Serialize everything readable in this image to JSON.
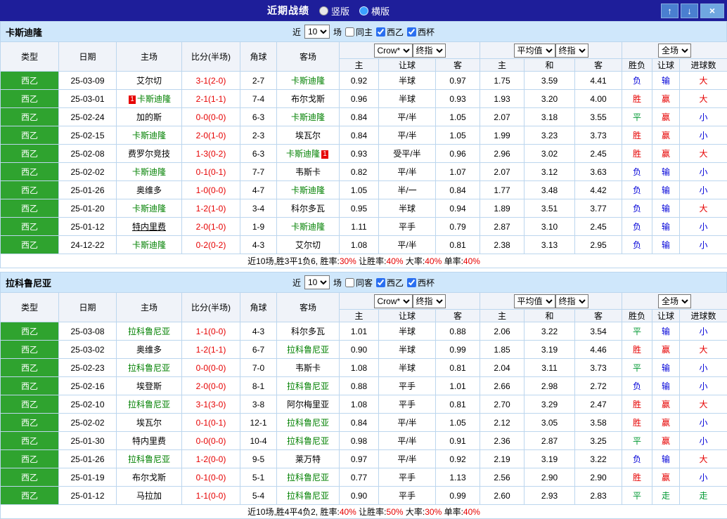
{
  "titlebar": {
    "title": "近期战绩",
    "layout_options": [
      {
        "label": "竖版",
        "selected": false
      },
      {
        "label": "横版",
        "selected": true
      }
    ],
    "buttons": {
      "up": "↑",
      "down": "↓",
      "close": "×"
    }
  },
  "colors": {
    "titlebar_bg": "#1e1e9a",
    "section_bg": "#cfe7fb",
    "header_bg": "#f0f3f9",
    "grid_border": "#bcd6ee",
    "league_badge_bg": "#2fa32f",
    "focus_team_green": "#008000",
    "result_red": "#e60000",
    "result_blue": "#0000d8",
    "result_green": "#009933"
  },
  "sections": [
    {
      "team": "卡斯迪隆",
      "filters": {
        "near_label": "近",
        "count": "10",
        "unit_label": "场",
        "checkboxes": [
          {
            "label": "同主",
            "checked": false
          },
          {
            "label": "西乙",
            "checked": true
          },
          {
            "label": "西杯",
            "checked": true
          }
        ]
      },
      "table": {
        "static_headers": [
          "类型",
          "日期",
          "主场",
          "比分(半场)",
          "角球",
          "客场"
        ],
        "odds_selects": [
          "Crow*",
          "终指"
        ],
        "odds_subheaders": [
          "主",
          "让球",
          "客"
        ],
        "avg_selects": [
          "平均值",
          "终指"
        ],
        "avg_subheaders": [
          "主",
          "和",
          "客"
        ],
        "result_select": "全场",
        "result_subheaders": [
          "胜负",
          "让球",
          "进球数"
        ]
      },
      "rows": [
        {
          "league": "西乙",
          "date": "25-03-09",
          "home": {
            "name": "艾尔切"
          },
          "score": "3-1(2-0)",
          "corners": "2-7",
          "away": {
            "name": "卡斯迪隆",
            "focus": true
          },
          "odds": [
            "0.92",
            "半球",
            "0.97"
          ],
          "averages": [
            "1.75",
            "3.59",
            "4.41"
          ],
          "results": [
            [
              "负",
              "blue"
            ],
            [
              "输",
              "blue"
            ],
            [
              "大",
              "red"
            ]
          ]
        },
        {
          "league": "西乙",
          "date": "25-03-01",
          "home": {
            "name": "卡斯迪隆",
            "focus": true,
            "badge_before": "1"
          },
          "score": "2-1(1-1)",
          "corners": "7-4",
          "away": {
            "name": "布尔戈斯"
          },
          "odds": [
            "0.96",
            "半球",
            "0.93"
          ],
          "averages": [
            "1.93",
            "3.20",
            "4.00"
          ],
          "results": [
            [
              "胜",
              "red"
            ],
            [
              "赢",
              "red"
            ],
            [
              "大",
              "red"
            ]
          ]
        },
        {
          "league": "西乙",
          "date": "25-02-24",
          "home": {
            "name": "加的斯"
          },
          "score": "0-0(0-0)",
          "corners": "6-3",
          "away": {
            "name": "卡斯迪隆",
            "focus": true
          },
          "odds": [
            "0.84",
            "平/半",
            "1.05"
          ],
          "averages": [
            "2.07",
            "3.18",
            "3.55"
          ],
          "results": [
            [
              "平",
              "green"
            ],
            [
              "赢",
              "red"
            ],
            [
              "小",
              "blue"
            ]
          ]
        },
        {
          "league": "西乙",
          "date": "25-02-15",
          "home": {
            "name": "卡斯迪隆",
            "focus": true
          },
          "score": "2-0(1-0)",
          "corners": "2-3",
          "away": {
            "name": "埃瓦尔"
          },
          "odds": [
            "0.84",
            "平/半",
            "1.05"
          ],
          "averages": [
            "1.99",
            "3.23",
            "3.73"
          ],
          "results": [
            [
              "胜",
              "red"
            ],
            [
              "赢",
              "red"
            ],
            [
              "小",
              "blue"
            ]
          ]
        },
        {
          "league": "西乙",
          "date": "25-02-08",
          "home": {
            "name": "费罗尔竞技"
          },
          "score": "1-3(0-2)",
          "corners": "6-3",
          "away": {
            "name": "卡斯迪隆",
            "focus": true,
            "badge_after": "1"
          },
          "odds": [
            "0.93",
            "受平/半",
            "0.96"
          ],
          "averages": [
            "2.96",
            "3.02",
            "2.45"
          ],
          "results": [
            [
              "胜",
              "red"
            ],
            [
              "赢",
              "red"
            ],
            [
              "大",
              "red"
            ]
          ]
        },
        {
          "league": "西乙",
          "date": "25-02-02",
          "home": {
            "name": "卡斯迪隆",
            "focus": true
          },
          "score": "0-1(0-1)",
          "corners": "7-7",
          "away": {
            "name": "韦斯卡"
          },
          "odds": [
            "0.82",
            "平/半",
            "1.07"
          ],
          "averages": [
            "2.07",
            "3.12",
            "3.63"
          ],
          "results": [
            [
              "负",
              "blue"
            ],
            [
              "输",
              "blue"
            ],
            [
              "小",
              "blue"
            ]
          ]
        },
        {
          "league": "西乙",
          "date": "25-01-26",
          "home": {
            "name": "奥维多"
          },
          "score": "1-0(0-0)",
          "corners": "4-7",
          "away": {
            "name": "卡斯迪隆",
            "focus": true
          },
          "odds": [
            "1.05",
            "半/一",
            "0.84"
          ],
          "averages": [
            "1.77",
            "3.48",
            "4.42"
          ],
          "results": [
            [
              "负",
              "blue"
            ],
            [
              "输",
              "blue"
            ],
            [
              "小",
              "blue"
            ]
          ]
        },
        {
          "league": "西乙",
          "date": "25-01-20",
          "home": {
            "name": "卡斯迪隆",
            "focus": true
          },
          "score": "1-2(1-0)",
          "corners": "3-4",
          "away": {
            "name": "科尔多瓦"
          },
          "odds": [
            "0.95",
            "半球",
            "0.94"
          ],
          "averages": [
            "1.89",
            "3.51",
            "3.77"
          ],
          "results": [
            [
              "负",
              "blue"
            ],
            [
              "输",
              "blue"
            ],
            [
              "大",
              "red"
            ]
          ]
        },
        {
          "league": "西乙",
          "date": "25-01-12",
          "home": {
            "name": "特内里费",
            "underline": true
          },
          "score": "2-0(1-0)",
          "corners": "1-9",
          "away": {
            "name": "卡斯迪隆",
            "focus": true
          },
          "odds": [
            "1.11",
            "平手",
            "0.79"
          ],
          "averages": [
            "2.87",
            "3.10",
            "2.45"
          ],
          "results": [
            [
              "负",
              "blue"
            ],
            [
              "输",
              "blue"
            ],
            [
              "小",
              "blue"
            ]
          ]
        },
        {
          "league": "西乙",
          "date": "24-12-22",
          "home": {
            "name": "卡斯迪隆",
            "focus": true
          },
          "score": "0-2(0-2)",
          "corners": "4-3",
          "away": {
            "name": "艾尔切"
          },
          "odds": [
            "1.08",
            "平/半",
            "0.81"
          ],
          "averages": [
            "2.38",
            "3.13",
            "2.95"
          ],
          "results": [
            [
              "负",
              "blue"
            ],
            [
              "输",
              "blue"
            ],
            [
              "小",
              "blue"
            ]
          ]
        }
      ],
      "summary": {
        "record": "近10场,胜3平1负6,",
        "stats": [
          {
            "label": "胜率:",
            "value": "30%"
          },
          {
            "label": "让胜率:",
            "value": "40%"
          },
          {
            "label": "大率:",
            "value": "40%"
          },
          {
            "label": "单率:",
            "value": "40%"
          }
        ]
      }
    },
    {
      "team": "拉科鲁尼亚",
      "filters": {
        "near_label": "近",
        "count": "10",
        "unit_label": "场",
        "checkboxes": [
          {
            "label": "同客",
            "checked": false
          },
          {
            "label": "西乙",
            "checked": true
          },
          {
            "label": "西杯",
            "checked": true
          }
        ]
      },
      "table": {
        "static_headers": [
          "类型",
          "日期",
          "主场",
          "比分(半场)",
          "角球",
          "客场"
        ],
        "odds_selects": [
          "Crow*",
          "终指"
        ],
        "odds_subheaders": [
          "主",
          "让球",
          "客"
        ],
        "avg_selects": [
          "平均值",
          "终指"
        ],
        "avg_subheaders": [
          "主",
          "和",
          "客"
        ],
        "result_select": "全场",
        "result_subheaders": [
          "胜负",
          "让球",
          "进球数"
        ]
      },
      "rows": [
        {
          "league": "西乙",
          "date": "25-03-08",
          "home": {
            "name": "拉科鲁尼亚",
            "focus": true
          },
          "score": "1-1(0-0)",
          "corners": "4-3",
          "away": {
            "name": "科尔多瓦"
          },
          "odds": [
            "1.01",
            "半球",
            "0.88"
          ],
          "averages": [
            "2.06",
            "3.22",
            "3.54"
          ],
          "results": [
            [
              "平",
              "green"
            ],
            [
              "输",
              "blue"
            ],
            [
              "小",
              "blue"
            ]
          ]
        },
        {
          "league": "西乙",
          "date": "25-03-02",
          "home": {
            "name": "奥维多"
          },
          "score": "1-2(1-1)",
          "corners": "6-7",
          "away": {
            "name": "拉科鲁尼亚",
            "focus": true
          },
          "odds": [
            "0.90",
            "半球",
            "0.99"
          ],
          "averages": [
            "1.85",
            "3.19",
            "4.46"
          ],
          "results": [
            [
              "胜",
              "red"
            ],
            [
              "赢",
              "red"
            ],
            [
              "大",
              "red"
            ]
          ]
        },
        {
          "league": "西乙",
          "date": "25-02-23",
          "home": {
            "name": "拉科鲁尼亚",
            "focus": true
          },
          "score": "0-0(0-0)",
          "corners": "7-0",
          "away": {
            "name": "韦斯卡"
          },
          "odds": [
            "1.08",
            "半球",
            "0.81"
          ],
          "averages": [
            "2.04",
            "3.11",
            "3.73"
          ],
          "results": [
            [
              "平",
              "green"
            ],
            [
              "输",
              "blue"
            ],
            [
              "小",
              "blue"
            ]
          ]
        },
        {
          "league": "西乙",
          "date": "25-02-16",
          "home": {
            "name": "埃登斯"
          },
          "score": "2-0(0-0)",
          "corners": "8-1",
          "away": {
            "name": "拉科鲁尼亚",
            "focus": true
          },
          "odds": [
            "0.88",
            "平手",
            "1.01"
          ],
          "averages": [
            "2.66",
            "2.98",
            "2.72"
          ],
          "results": [
            [
              "负",
              "blue"
            ],
            [
              "输",
              "blue"
            ],
            [
              "小",
              "blue"
            ]
          ]
        },
        {
          "league": "西乙",
          "date": "25-02-10",
          "home": {
            "name": "拉科鲁尼亚",
            "focus": true
          },
          "score": "3-1(3-0)",
          "corners": "3-8",
          "away": {
            "name": "阿尔梅里亚"
          },
          "odds": [
            "1.08",
            "平手",
            "0.81"
          ],
          "averages": [
            "2.70",
            "3.29",
            "2.47"
          ],
          "results": [
            [
              "胜",
              "red"
            ],
            [
              "赢",
              "red"
            ],
            [
              "大",
              "red"
            ]
          ]
        },
        {
          "league": "西乙",
          "date": "25-02-02",
          "home": {
            "name": "埃瓦尔"
          },
          "score": "0-1(0-1)",
          "corners": "12-1",
          "away": {
            "name": "拉科鲁尼亚",
            "focus": true
          },
          "odds": [
            "0.84",
            "平/半",
            "1.05"
          ],
          "averages": [
            "2.12",
            "3.05",
            "3.58"
          ],
          "results": [
            [
              "胜",
              "red"
            ],
            [
              "赢",
              "red"
            ],
            [
              "小",
              "blue"
            ]
          ]
        },
        {
          "league": "西乙",
          "date": "25-01-30",
          "home": {
            "name": "特内里费"
          },
          "score": "0-0(0-0)",
          "corners": "10-4",
          "away": {
            "name": "拉科鲁尼亚",
            "focus": true
          },
          "odds": [
            "0.98",
            "平/半",
            "0.91"
          ],
          "averages": [
            "2.36",
            "2.87",
            "3.25"
          ],
          "results": [
            [
              "平",
              "green"
            ],
            [
              "赢",
              "red"
            ],
            [
              "小",
              "blue"
            ]
          ]
        },
        {
          "league": "西乙",
          "date": "25-01-26",
          "home": {
            "name": "拉科鲁尼亚",
            "focus": true
          },
          "score": "1-2(0-0)",
          "corners": "9-5",
          "away": {
            "name": "莱万特"
          },
          "odds": [
            "0.97",
            "平/半",
            "0.92"
          ],
          "averages": [
            "2.19",
            "3.19",
            "3.22"
          ],
          "results": [
            [
              "负",
              "blue"
            ],
            [
              "输",
              "blue"
            ],
            [
              "大",
              "red"
            ]
          ]
        },
        {
          "league": "西乙",
          "date": "25-01-19",
          "home": {
            "name": "布尔戈斯"
          },
          "score": "0-1(0-0)",
          "corners": "5-1",
          "away": {
            "name": "拉科鲁尼亚",
            "focus": true
          },
          "odds": [
            "0.77",
            "平手",
            "1.13"
          ],
          "averages": [
            "2.56",
            "2.90",
            "2.90"
          ],
          "results": [
            [
              "胜",
              "red"
            ],
            [
              "赢",
              "red"
            ],
            [
              "小",
              "blue"
            ]
          ]
        },
        {
          "league": "西乙",
          "date": "25-01-12",
          "home": {
            "name": "马拉加"
          },
          "score": "1-1(0-0)",
          "corners": "5-4",
          "away": {
            "name": "拉科鲁尼亚",
            "focus": true
          },
          "odds": [
            "0.90",
            "平手",
            "0.99"
          ],
          "averages": [
            "2.60",
            "2.93",
            "2.83"
          ],
          "results": [
            [
              "平",
              "green"
            ],
            [
              "走",
              "green"
            ],
            [
              "走",
              "green"
            ]
          ]
        }
      ],
      "summary": {
        "record": "近10场,胜4平4负2,",
        "stats": [
          {
            "label": "胜率:",
            "value": "40%"
          },
          {
            "label": "让胜率:",
            "value": "50%"
          },
          {
            "label": "大率:",
            "value": "30%"
          },
          {
            "label": "单率:",
            "value": "40%"
          }
        ]
      }
    }
  ]
}
